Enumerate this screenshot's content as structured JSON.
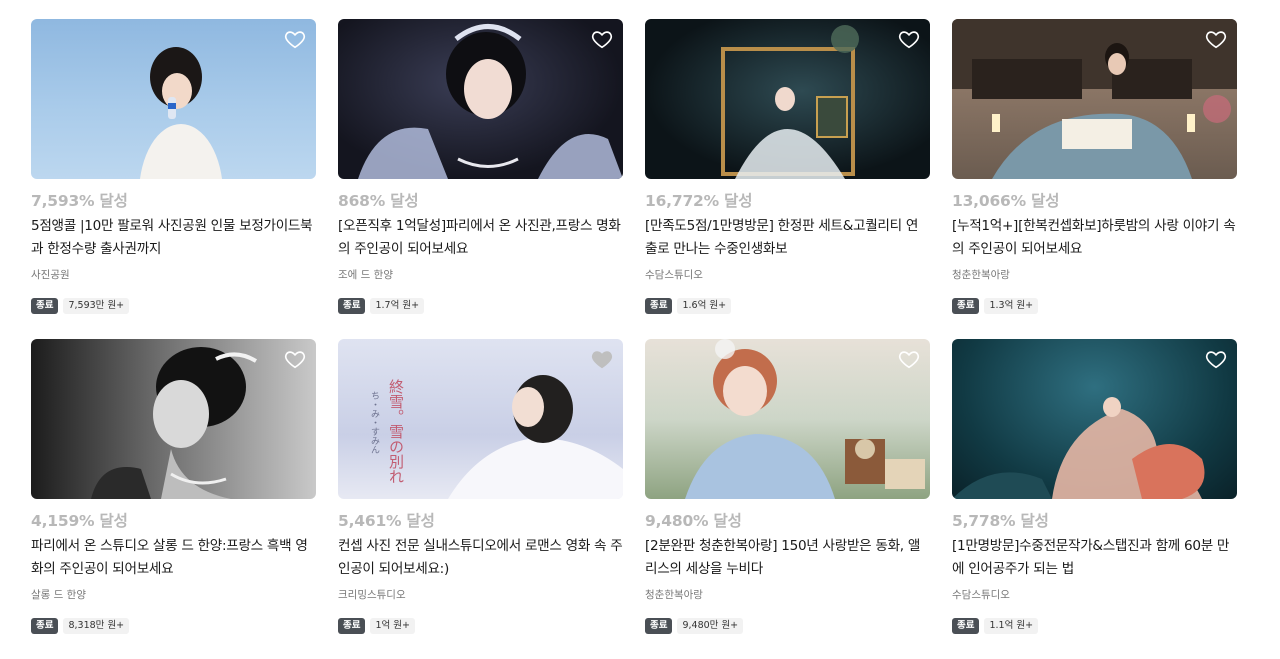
{
  "cards": [
    {
      "percent": "7,593% 달성",
      "title": "5점앵콜 |10만 팔로워 사진공원 인물 보정가이드북과 한정수량 출사권까지",
      "maker": "사진공원",
      "status": "종료",
      "amount": "7,593만 원+",
      "liked": false
    },
    {
      "percent": "868% 달성",
      "title": "[오픈직후 1억달성]파리에서 온 사진관,프랑스 명화의 주인공이 되어보세요",
      "maker": "조에 드 한양",
      "status": "종료",
      "amount": "1.7억 원+",
      "liked": false
    },
    {
      "percent": "16,772% 달성",
      "title": "[만족도5점/1만명방문] 한정판 세트&고퀄리티 연출로 만나는 수중인생화보",
      "maker": "수담스튜디오",
      "status": "종료",
      "amount": "1.6억 원+",
      "liked": false
    },
    {
      "percent": "13,066% 달성",
      "title": "[누적1억+][한복컨셉화보]하룻밤의 사랑 이야기 속의 주인공이 되어보세요",
      "maker": "청춘한복아랑",
      "status": "종료",
      "amount": "1.3억 원+",
      "liked": false
    },
    {
      "percent": "4,159% 달성",
      "title": "파리에서 온 스튜디오 살롱 드 한양:프랑스 흑백 영화의 주인공이 되어보세요",
      "maker": "살롱 드 한양",
      "status": "종료",
      "amount": "8,318만 원+",
      "liked": false
    },
    {
      "percent": "5,461% 달성",
      "title": "컨셉 사진 전문 실내스튜디오에서 로맨스 영화 속 주인공이 되어보세요:)",
      "maker": "크리밍스튜디오",
      "status": "종료",
      "amount": "1억 원+",
      "liked": true
    },
    {
      "percent": "9,480% 달성",
      "title": "[2분완판 청춘한복아랑] 150년 사랑받은 동화, 앨리스의 세상을 누비다",
      "maker": "청춘한복아랑",
      "status": "종료",
      "amount": "9,480만 원+",
      "liked": false
    },
    {
      "percent": "5,778% 달성",
      "title": "[1만명방문]수중전문작가&스탭진과 함께 60분 만에 인어공주가 되는 법",
      "maker": "수담스튜디오",
      "status": "종료",
      "amount": "1.1억 원+",
      "liked": false
    }
  ],
  "poster_text": {
    "vertical_title": "終雪。雪の別れ",
    "vertical_sub": "ち・み・すみん"
  },
  "colors": {
    "percent_gray": "#b8b8b8",
    "badge_bg": "#4a4f55",
    "amount_bg": "#f2f2f2",
    "heart_stroke": "#ffffff",
    "heart_fill_liked": "#bfbfbf"
  },
  "icons": {
    "heart": "heart-icon"
  }
}
